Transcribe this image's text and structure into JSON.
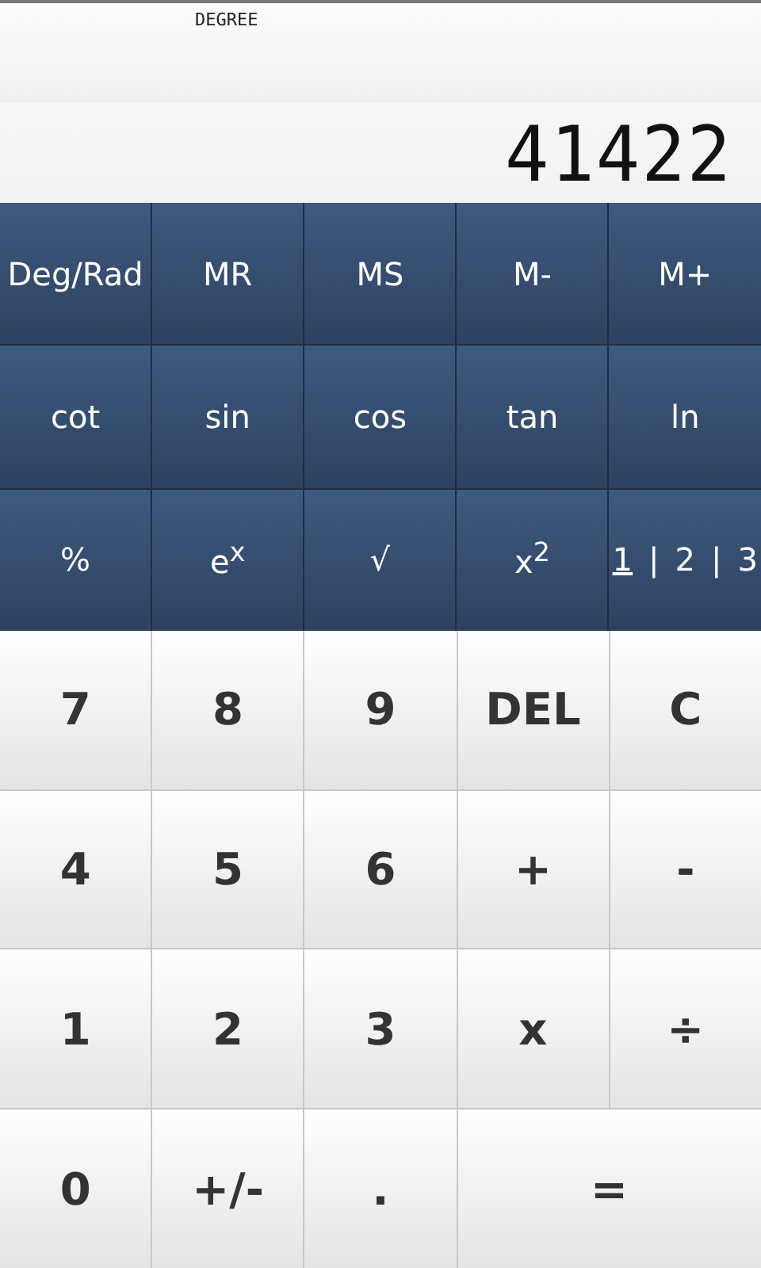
{
  "display": {
    "mode": "DEGREE",
    "value": "41422"
  },
  "function_rows": [
    [
      "Deg/Rad",
      "MR",
      "MS",
      "M-",
      "M+"
    ],
    [
      "cot",
      "sin",
      "cos",
      "tan",
      "ln"
    ],
    [
      "%",
      "e$^{x}$",
      "√",
      "x$^{2}$"
    ]
  ],
  "pages": [
    {
      "label": "1",
      "selected": true
    },
    {
      "label": "2",
      "selected": false
    },
    {
      "label": "3",
      "selected": false
    }
  ],
  "page_separators": [
    "|",
    "|"
  ],
  "keypad": [
    {
      "label": "7",
      "kind": "normal"
    },
    {
      "label": "8",
      "kind": "normal"
    },
    {
      "label": "9",
      "kind": "normal"
    },
    {
      "label": "DEL",
      "kind": "normal"
    },
    {
      "label": "C",
      "kind": "normal"
    },
    {
      "label": "4",
      "kind": "normal"
    },
    {
      "label": "5",
      "kind": "normal"
    },
    {
      "label": "6",
      "kind": "normal"
    },
    {
      "label": "+",
      "kind": "normal"
    },
    {
      "label": "-",
      "kind": "normal"
    },
    {
      "label": "1",
      "kind": "normal"
    },
    {
      "label": "2",
      "kind": "normal"
    },
    {
      "label": "3",
      "kind": "normal"
    },
    {
      "label": "x",
      "kind": "normal"
    },
    {
      "label": "÷",
      "kind": "normal"
    },
    {
      "label": "0",
      "kind": "normal"
    },
    {
      "label": "+/-",
      "kind": "normal"
    },
    {
      "label": ".",
      "kind": "normal"
    },
    {
      "label": "=",
      "kind": "wide"
    }
  ]
}
